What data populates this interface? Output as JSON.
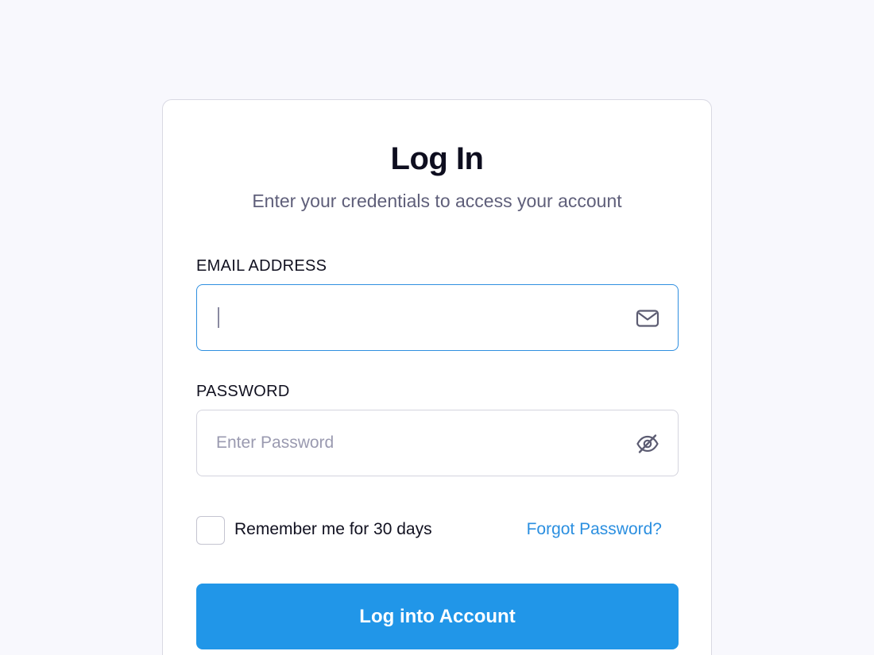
{
  "login": {
    "title": "Log In",
    "subtitle": "Enter your credentials to access your account",
    "email": {
      "label": "EMAIL ADDRESS",
      "value": "",
      "placeholder": "",
      "icon": "envelope-icon"
    },
    "password": {
      "label": "PASSWORD",
      "value": "",
      "placeholder": "Enter Password",
      "icon": "eye-slash-icon"
    },
    "remember": {
      "label": "Remember me for 30 days",
      "checked": false
    },
    "forgot_label": "Forgot Password?",
    "submit_label": "Log into Account"
  },
  "colors": {
    "page_background": "#f8f8fd",
    "accent": "#2196e8",
    "link": "#2b8fe0",
    "focus_border": "#2f8fe0"
  }
}
